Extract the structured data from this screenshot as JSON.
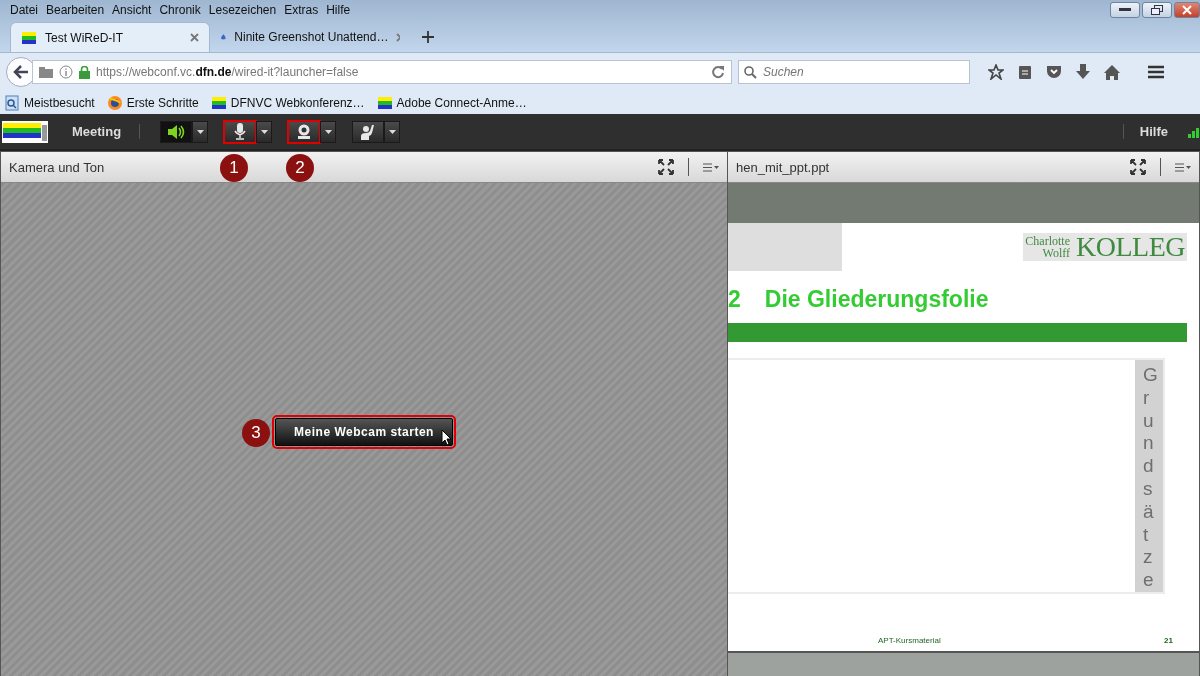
{
  "menu_bar": [
    "Datei",
    "Bearbeiten",
    "Ansicht",
    "Chronik",
    "Lesezeichen",
    "Extras",
    "Hilfe"
  ],
  "tabs": [
    {
      "label": "Test WiReD-IT",
      "selected": true
    },
    {
      "label": "Ninite Greenshot Unattend…",
      "selected": false
    }
  ],
  "address": {
    "url": "https://webconf.vc.**dfn.de**/wired-it?launcher=false"
  },
  "search": {
    "placeholder": "Suchen"
  },
  "bookmarks": [
    {
      "label": "Meistbesucht"
    },
    {
      "label": "Erste Schritte"
    },
    {
      "label": "DFNVC Webkonferenz…"
    },
    {
      "label": "Adobe Connect-Anme…"
    }
  ],
  "app_toolbar": {
    "menu": "Meeting",
    "help": "Hilfe",
    "buttons": [
      {
        "kind": "speaker",
        "active": true,
        "highlighted": false
      },
      {
        "kind": "mic",
        "active": false,
        "highlighted": true
      },
      {
        "kind": "camera",
        "active": false,
        "highlighted": true
      },
      {
        "kind": "hand",
        "active": false,
        "highlighted": false
      }
    ]
  },
  "camera_pod": {
    "title": "Kamera und Ton",
    "start_button": {
      "label": "Meine Webcam starten",
      "highlighted": true
    }
  },
  "share_pod": {
    "title": "hen_mit_ppt.ppt",
    "slide": {
      "logo_small": [
        "Charlotte",
        "Wolff"
      ],
      "logo_big": "KOLLEG",
      "heading_number": "2",
      "heading": "Die Gliederungsfolie",
      "side_label": "Grundsätze",
      "footer": "APT-Kursmaterial",
      "page": "21"
    }
  },
  "callouts": [
    "1",
    "2",
    "3"
  ]
}
